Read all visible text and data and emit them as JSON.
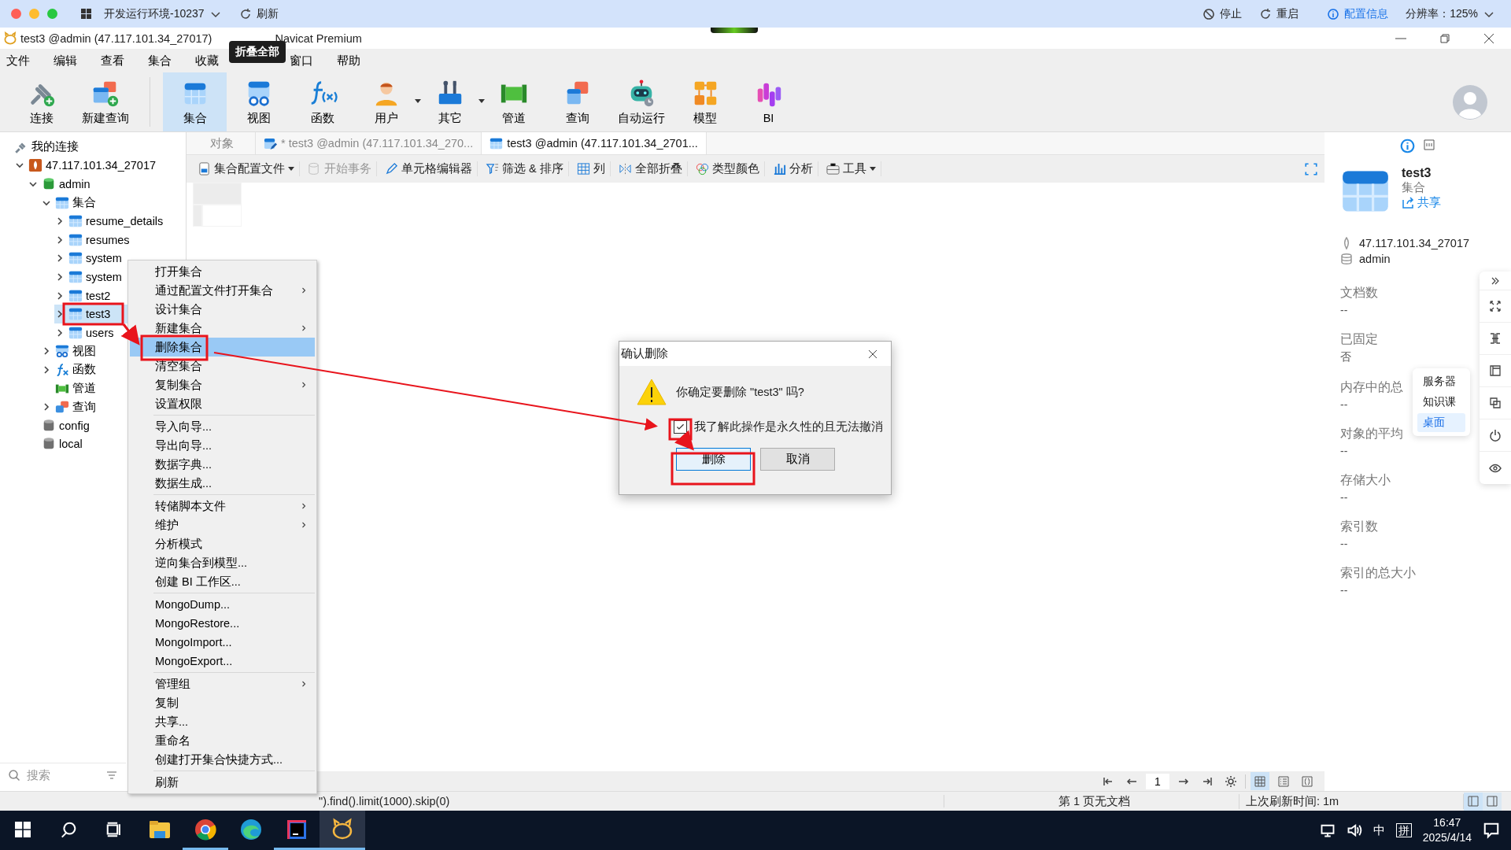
{
  "remote_bar": {
    "env": "开发运行环境-10237",
    "refresh": "刷新",
    "actions": [
      {
        "kind": "stop",
        "label": "停止"
      },
      {
        "kind": "restart",
        "label": "重启"
      }
    ],
    "config": "配置信息",
    "resolution": "分辨率：125%"
  },
  "window": {
    "title": "test3 @admin (47.117.101.34_27017)",
    "app": "Navicat Premium"
  },
  "tooltip": "折叠全部",
  "menu": [
    "文件",
    "编辑",
    "查看",
    "集合",
    "收藏",
    "窗口",
    "帮助"
  ],
  "toolbar": [
    {
      "kind": "connect",
      "label": "连接",
      "selected": false,
      "dropdown": false
    },
    {
      "kind": "newquery",
      "label": "新建查询",
      "selected": false,
      "dropdown": false
    },
    {
      "kind": "collection",
      "label": "集合",
      "selected": true,
      "dropdown": false
    },
    {
      "kind": "view",
      "label": "视图",
      "selected": false,
      "dropdown": false
    },
    {
      "kind": "function",
      "label": "函数",
      "selected": false,
      "dropdown": false
    },
    {
      "kind": "user",
      "label": "用户",
      "selected": false,
      "dropdown": true
    },
    {
      "kind": "other",
      "label": "其它",
      "selected": false,
      "dropdown": true
    },
    {
      "kind": "pipeline",
      "label": "管道",
      "selected": false,
      "dropdown": false
    },
    {
      "kind": "query",
      "label": "查询",
      "selected": false,
      "dropdown": false
    },
    {
      "kind": "autorun",
      "label": "自动运行",
      "selected": false,
      "dropdown": false
    },
    {
      "kind": "model",
      "label": "模型",
      "selected": false,
      "dropdown": false
    },
    {
      "kind": "bi",
      "label": "BI",
      "selected": false,
      "dropdown": false
    }
  ],
  "sidebar": {
    "title": "我的连接",
    "search": {
      "placeholder": "搜索"
    },
    "tree": [
      {
        "label": "47.117.101.34_27017",
        "kind": "connection",
        "expanded": true,
        "selected": false,
        "children": [
          {
            "label": "admin",
            "kind": "database",
            "expanded": true,
            "selected": false,
            "children": [
              {
                "label": "集合",
                "kind": "collection",
                "expanded": true,
                "selected": false,
                "children": [
                  {
                    "label": "resume_details",
                    "kind": "collection",
                    "expanded": false,
                    "selected": false
                  },
                  {
                    "label": "resumes",
                    "kind": "collection",
                    "expanded": false,
                    "selected": false
                  },
                  {
                    "label": "system",
                    "kind": "collection",
                    "expanded": false,
                    "selected": false
                  },
                  {
                    "label": "system",
                    "kind": "collection",
                    "expanded": false,
                    "selected": false
                  },
                  {
                    "label": "test2",
                    "kind": "collection",
                    "expanded": false,
                    "selected": false
                  },
                  {
                    "label": "test3",
                    "kind": "collection",
                    "expanded": false,
                    "selected": true
                  },
                  {
                    "label": "users",
                    "kind": "collection",
                    "expanded": false,
                    "selected": false
                  }
                ]
              },
              {
                "label": "视图",
                "kind": "view",
                "expanded": false,
                "selected": false
              },
              {
                "label": "函数",
                "kind": "function",
                "expanded": false,
                "selected": false
              },
              {
                "label": "管道",
                "kind": "pipeline",
                "selected": false
              },
              {
                "label": "查询",
                "kind": "query",
                "expanded": false,
                "selected": false
              }
            ]
          },
          {
            "label": "config",
            "kind": "database-gray",
            "selected": false
          },
          {
            "label": "local",
            "kind": "database-gray",
            "selected": false
          }
        ]
      }
    ]
  },
  "tabs": [
    {
      "label": "对象",
      "kind": "plain",
      "selected": false
    },
    {
      "label": "* test3 @admin (47.117.101.34_270...",
      "kind": "edit",
      "selected": false
    },
    {
      "label": "test3 @admin (47.117.101.34_2701...",
      "kind": "collection",
      "selected": true
    }
  ],
  "object_toolbar": [
    {
      "kind": "profile",
      "label": "集合配置文件",
      "dropdown": true,
      "disabled": false
    },
    {
      "kind": "transaction",
      "label": "开始事务",
      "dropdown": false,
      "disabled": true
    },
    {
      "kind": "cell-editor",
      "label": "单元格编辑器",
      "dropdown": false,
      "disabled": false
    },
    {
      "kind": "filter",
      "label": "筛选 & 排序",
      "dropdown": false,
      "disabled": false
    },
    {
      "kind": "columns",
      "label": "列",
      "dropdown": false,
      "disabled": false
    },
    {
      "kind": "collapse",
      "label": "全部折叠",
      "dropdown": false,
      "disabled": false
    },
    {
      "kind": "colors",
      "label": "类型颜色",
      "dropdown": false,
      "disabled": false
    },
    {
      "kind": "analyze",
      "label": "分析",
      "dropdown": false,
      "disabled": false
    },
    {
      "kind": "tools",
      "label": "工具",
      "dropdown": true,
      "disabled": false
    }
  ],
  "context_menu": [
    {
      "kind": "item",
      "label": "打开集合",
      "submenu": false,
      "selected": false
    },
    {
      "kind": "item",
      "label": "通过配置文件打开集合",
      "submenu": true,
      "selected": false
    },
    {
      "kind": "item",
      "label": "设计集合",
      "submenu": false,
      "selected": false
    },
    {
      "kind": "item",
      "label": "新建集合",
      "submenu": true,
      "selected": false
    },
    {
      "kind": "item",
      "label": "删除集合",
      "submenu": false,
      "selected": true
    },
    {
      "kind": "item",
      "label": "清空集合",
      "submenu": false,
      "selected": false
    },
    {
      "kind": "item",
      "label": "复制集合",
      "submenu": true,
      "selected": false
    },
    {
      "kind": "item",
      "label": "设置权限",
      "submenu": false,
      "selected": false
    },
    {
      "kind": "separator"
    },
    {
      "kind": "item",
      "label": "导入向导...",
      "submenu": false,
      "selected": false
    },
    {
      "kind": "item",
      "label": "导出向导...",
      "submenu": false,
      "selected": false
    },
    {
      "kind": "item",
      "label": "数据字典...",
      "submenu": false,
      "selected": false
    },
    {
      "kind": "item",
      "label": "数据生成...",
      "submenu": false,
      "selected": false
    },
    {
      "kind": "separator"
    },
    {
      "kind": "item",
      "label": "转储脚本文件",
      "submenu": true,
      "selected": false
    },
    {
      "kind": "item",
      "label": "维护",
      "submenu": true,
      "selected": false
    },
    {
      "kind": "item",
      "label": "分析模式",
      "submenu": false,
      "selected": false
    },
    {
      "kind": "item",
      "label": "逆向集合到模型...",
      "submenu": false,
      "selected": false
    },
    {
      "kind": "item",
      "label": "创建 BI 工作区...",
      "submenu": false,
      "selected": false
    },
    {
      "kind": "separator"
    },
    {
      "kind": "item",
      "label": "MongoDump...",
      "submenu": false,
      "selected": false
    },
    {
      "kind": "item",
      "label": "MongoRestore...",
      "submenu": false,
      "selected": false
    },
    {
      "kind": "item",
      "label": "MongoImport...",
      "submenu": false,
      "selected": false
    },
    {
      "kind": "item",
      "label": "MongoExport...",
      "submenu": false,
      "selected": false
    },
    {
      "kind": "separator"
    },
    {
      "kind": "item",
      "label": "管理组",
      "submenu": true,
      "selected": false
    },
    {
      "kind": "item",
      "label": "复制",
      "submenu": false,
      "selected": false
    },
    {
      "kind": "item",
      "label": "共享...",
      "submenu": false,
      "selected": false
    },
    {
      "kind": "item",
      "label": "重命名",
      "submenu": false,
      "selected": false
    },
    {
      "kind": "item",
      "label": "创建打开集合快捷方式...",
      "submenu": false,
      "selected": false
    },
    {
      "kind": "separator"
    },
    {
      "kind": "item",
      "label": "刷新",
      "submenu": false,
      "selected": false
    }
  ],
  "dialog": {
    "title": "确认删除",
    "message": "你确定要删除 \"test3\" 吗?",
    "checkbox": {
      "label": "我了解此操作是永久性的且无法撤消",
      "checked": true
    },
    "buttons": [
      {
        "label": "删除",
        "default": true
      },
      {
        "label": "取消",
        "default": false
      }
    ]
  },
  "info_panel": {
    "name": "test3",
    "type": "集合",
    "share": "共享",
    "connection": "47.117.101.34_27017",
    "database": "admin",
    "properties": [
      {
        "label": "文档数",
        "value": "--"
      },
      {
        "label": "已固定",
        "value": "否"
      },
      {
        "label": "内存中的总",
        "value": "--"
      },
      {
        "label": "对象的平均",
        "value": "--"
      },
      {
        "label": "存储大小",
        "value": "--"
      },
      {
        "label": "索引数",
        "value": "--"
      },
      {
        "label": "索引的总大小",
        "value": "--"
      }
    ]
  },
  "remote_menu": [
    {
      "label": "服务器",
      "selected": false
    },
    {
      "label": "知识课",
      "selected": false
    },
    {
      "label": "桌面",
      "selected": true
    }
  ],
  "pager": {
    "page": "1",
    "views": [
      {
        "kind": "grid",
        "selected": true
      },
      {
        "kind": "form",
        "selected": false
      },
      {
        "kind": "json",
        "selected": false
      }
    ]
  },
  "status_bar": {
    "query": "\").find().limit(1000).skip(0)",
    "page_info": "第 1 页无文档",
    "refresh_time": "上次刷新时间: 1m",
    "panels": [
      {
        "kind": "left",
        "selected": true
      },
      {
        "kind": "right",
        "selected": false
      }
    ]
  },
  "taskbar": {
    "apps": [
      {
        "kind": "explorer",
        "running": false,
        "selected": false
      },
      {
        "kind": "chrome",
        "running": true,
        "selected": false
      },
      {
        "kind": "edge",
        "running": false,
        "selected": false
      },
      {
        "kind": "intellij",
        "running": true,
        "selected": false
      },
      {
        "kind": "navicat",
        "running": true,
        "selected": true
      }
    ],
    "ime": "中",
    "ime_mode": "拼",
    "time": "16:47",
    "date": "2025/4/14"
  }
}
